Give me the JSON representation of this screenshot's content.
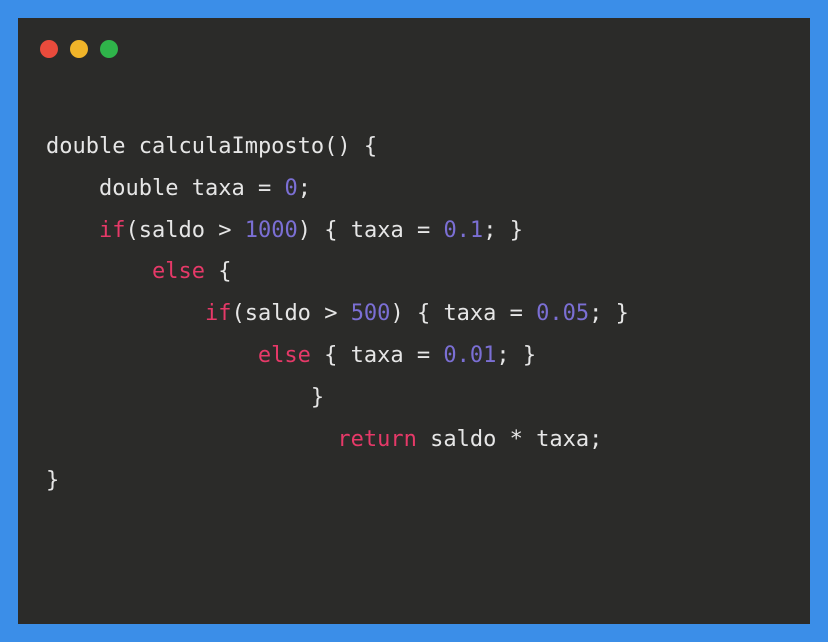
{
  "window": {
    "buttons": {
      "close": "red",
      "minimize": "yellow",
      "maximize": "green"
    }
  },
  "code": {
    "lines": [
      {
        "indent": 0,
        "tokens": [
          {
            "t": "type",
            "v": "double"
          },
          {
            "t": "sp",
            "v": " "
          },
          {
            "t": "ident",
            "v": "calculaImposto"
          },
          {
            "t": "punct",
            "v": "()"
          },
          {
            "t": "sp",
            "v": " "
          },
          {
            "t": "punct",
            "v": "{"
          }
        ]
      },
      {
        "indent": 4,
        "tokens": [
          {
            "t": "type",
            "v": "double"
          },
          {
            "t": "sp",
            "v": " "
          },
          {
            "t": "ident",
            "v": "taxa"
          },
          {
            "t": "sp",
            "v": " "
          },
          {
            "t": "op",
            "v": "="
          },
          {
            "t": "sp",
            "v": " "
          },
          {
            "t": "num",
            "v": "0"
          },
          {
            "t": "punct",
            "v": ";"
          }
        ]
      },
      {
        "indent": 4,
        "tokens": [
          {
            "t": "kw",
            "v": "if"
          },
          {
            "t": "punct",
            "v": "("
          },
          {
            "t": "ident",
            "v": "saldo"
          },
          {
            "t": "sp",
            "v": " "
          },
          {
            "t": "op",
            "v": ">"
          },
          {
            "t": "sp",
            "v": " "
          },
          {
            "t": "num",
            "v": "1000"
          },
          {
            "t": "punct",
            "v": ")"
          },
          {
            "t": "sp",
            "v": " "
          },
          {
            "t": "punct",
            "v": "{"
          },
          {
            "t": "sp",
            "v": " "
          },
          {
            "t": "ident",
            "v": "taxa"
          },
          {
            "t": "sp",
            "v": " "
          },
          {
            "t": "op",
            "v": "="
          },
          {
            "t": "sp",
            "v": " "
          },
          {
            "t": "num",
            "v": "0.1"
          },
          {
            "t": "punct",
            "v": ";"
          },
          {
            "t": "sp",
            "v": " "
          },
          {
            "t": "punct",
            "v": "}"
          }
        ]
      },
      {
        "indent": 8,
        "tokens": [
          {
            "t": "kw",
            "v": "else"
          },
          {
            "t": "sp",
            "v": " "
          },
          {
            "t": "punct",
            "v": "{"
          }
        ]
      },
      {
        "indent": 12,
        "tokens": [
          {
            "t": "kw",
            "v": "if"
          },
          {
            "t": "punct",
            "v": "("
          },
          {
            "t": "ident",
            "v": "saldo"
          },
          {
            "t": "sp",
            "v": " "
          },
          {
            "t": "op",
            "v": ">"
          },
          {
            "t": "sp",
            "v": " "
          },
          {
            "t": "num",
            "v": "500"
          },
          {
            "t": "punct",
            "v": ")"
          },
          {
            "t": "sp",
            "v": " "
          },
          {
            "t": "punct",
            "v": "{"
          },
          {
            "t": "sp",
            "v": " "
          },
          {
            "t": "ident",
            "v": "taxa"
          },
          {
            "t": "sp",
            "v": " "
          },
          {
            "t": "op",
            "v": "="
          },
          {
            "t": "sp",
            "v": " "
          },
          {
            "t": "num",
            "v": "0.05"
          },
          {
            "t": "punct",
            "v": ";"
          },
          {
            "t": "sp",
            "v": " "
          },
          {
            "t": "punct",
            "v": "}"
          }
        ]
      },
      {
        "indent": 16,
        "tokens": [
          {
            "t": "kw",
            "v": "else"
          },
          {
            "t": "sp",
            "v": " "
          },
          {
            "t": "punct",
            "v": "{"
          },
          {
            "t": "sp",
            "v": " "
          },
          {
            "t": "ident",
            "v": "taxa"
          },
          {
            "t": "sp",
            "v": " "
          },
          {
            "t": "op",
            "v": "="
          },
          {
            "t": "sp",
            "v": " "
          },
          {
            "t": "num",
            "v": "0.01"
          },
          {
            "t": "punct",
            "v": ";"
          },
          {
            "t": "sp",
            "v": " "
          },
          {
            "t": "punct",
            "v": "}"
          }
        ]
      },
      {
        "indent": 20,
        "tokens": [
          {
            "t": "punct",
            "v": "}"
          }
        ]
      },
      {
        "indent": 22,
        "tokens": [
          {
            "t": "kw",
            "v": "return"
          },
          {
            "t": "sp",
            "v": " "
          },
          {
            "t": "ident",
            "v": "saldo"
          },
          {
            "t": "sp",
            "v": " "
          },
          {
            "t": "op",
            "v": "*"
          },
          {
            "t": "sp",
            "v": " "
          },
          {
            "t": "ident",
            "v": "taxa"
          },
          {
            "t": "punct",
            "v": ";"
          }
        ]
      },
      {
        "indent": 0,
        "tokens": [
          {
            "t": "punct",
            "v": "}"
          }
        ]
      }
    ]
  }
}
